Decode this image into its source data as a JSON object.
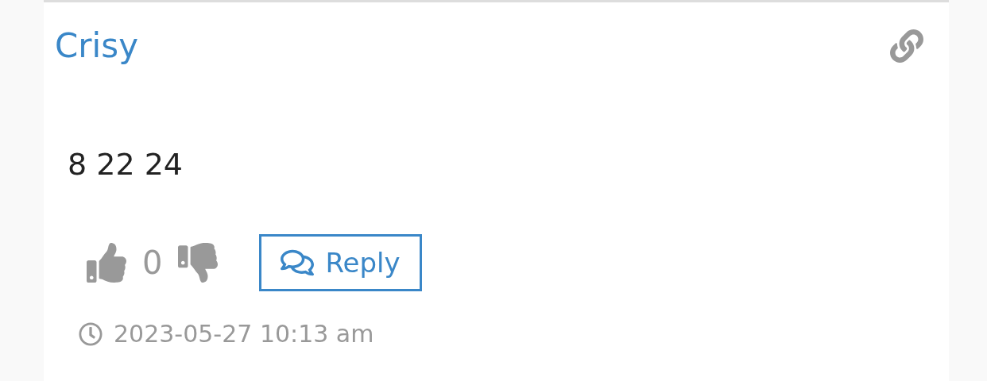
{
  "comment": {
    "author": "Crisy",
    "body": "8 22 24",
    "votes": {
      "count": "0"
    },
    "reply_button": "Reply",
    "timestamp": "2023-05-27 10:13 am"
  }
}
